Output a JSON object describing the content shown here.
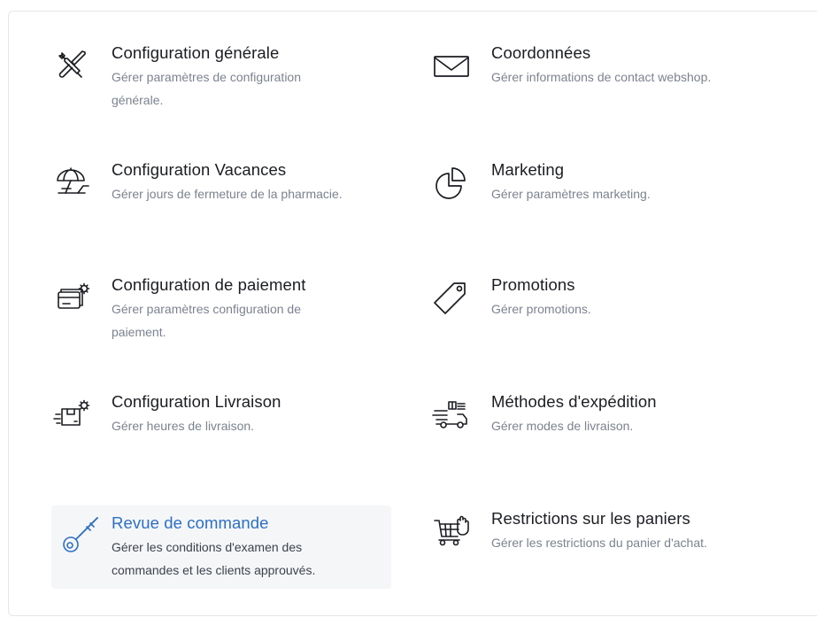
{
  "settings": {
    "items": [
      {
        "title": "Configuration générale",
        "description": "Gérer paramètres de configuration générale.",
        "icon": "tools-icon"
      },
      {
        "title": "Coordonnées",
        "description": "Gérer informations de contact webshop.",
        "icon": "envelope-icon"
      },
      {
        "title": "Configuration Vacances",
        "description": "Gérer jours de fermeture de la pharmacie.",
        "icon": "beach-umbrella-icon"
      },
      {
        "title": "Marketing",
        "description": "Gérer paramètres marketing.",
        "icon": "pie-chart-icon"
      },
      {
        "title": "Configuration de paiement",
        "description": "Gérer paramètres configuration de paiement.",
        "icon": "payment-cards-gear-icon"
      },
      {
        "title": "Promotions",
        "description": "Gérer promotions.",
        "icon": "price-tag-icon"
      },
      {
        "title": "Configuration Livraison",
        "description": "Gérer heures de livraison.",
        "icon": "delivery-box-gear-icon"
      },
      {
        "title": "Méthodes d'expédition",
        "description": "Gérer modes de livraison.",
        "icon": "fast-truck-icon"
      },
      {
        "title": "Revue de commande",
        "description": "Gérer les conditions d'examen des commandes et les clients approuvés.",
        "icon": "key-icon",
        "active": true
      },
      {
        "title": "Restrictions sur les paniers",
        "description": "Gérer les restrictions du panier d'achat.",
        "icon": "cart-hand-icon"
      }
    ]
  },
  "colors": {
    "accent": "#2d6fc4",
    "title": "#1a1d21",
    "description": "#7b8390",
    "active_background": "#f5f6f8",
    "panel_border": "#e3e6ea"
  }
}
